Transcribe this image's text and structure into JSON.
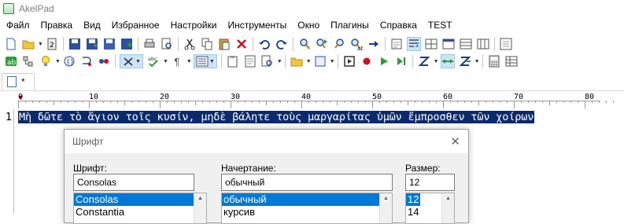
{
  "window": {
    "title": "AkelPad"
  },
  "menu": [
    "Файл",
    "Правка",
    "Вид",
    "Избранное",
    "Настройки",
    "Инструменты",
    "Окно",
    "Плагины",
    "Справка",
    "TEST"
  ],
  "tab": {
    "label": "*"
  },
  "ruler": {
    "labels": [
      "0",
      "10",
      "20",
      "30",
      "40",
      "50",
      "60",
      "70",
      "80"
    ]
  },
  "editor": {
    "line_number": "1",
    "line_text": "Μὴ δῶτε τὸ ἅγιον τοῖς κυσίν, μηδὲ βάλητε τοὺς μαργαρίτας ὑμῶν ἔμπροσθεν τῶν χοίρων"
  },
  "font_dialog": {
    "title": "Шрифт",
    "font_label": "Шрифт:",
    "font_value": "Consolas",
    "font_list": [
      "Consolas",
      "Constantia"
    ],
    "style_label": "Начертание:",
    "style_value": "обычный",
    "style_list": [
      "обычный",
      "курсив"
    ],
    "size_label": "Размер:",
    "size_value": "12",
    "size_list": [
      "12",
      "14"
    ]
  },
  "colors": {
    "selection": "#0b2a6b",
    "list_highlight": "#0078d7",
    "ruler_marker": "#c00000"
  }
}
